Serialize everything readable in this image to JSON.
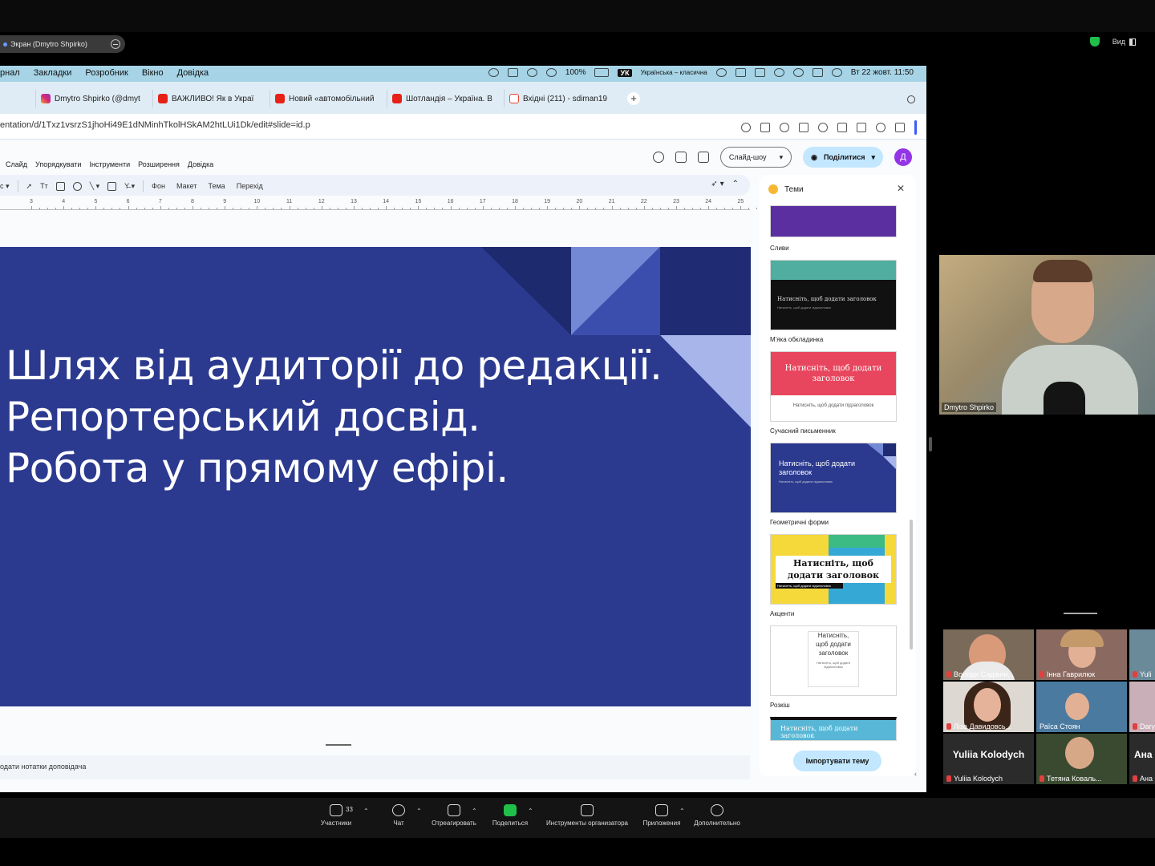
{
  "zoom": {
    "share_label": "Экран (Dmytro Shpirko)",
    "view_label": "Вид",
    "bottom_controls": [
      {
        "label": "Участники",
        "count": "33",
        "icon": "participants-icon"
      },
      {
        "label": "Чат",
        "icon": "chat-icon"
      },
      {
        "label": "Отреагировать",
        "icon": "heart-icon"
      },
      {
        "label": "Поделиться",
        "icon": "share-screen-icon"
      },
      {
        "label": "Инструменты организатора",
        "icon": "shield-icon"
      },
      {
        "label": "Приложения",
        "icon": "apps-icon"
      },
      {
        "label": "Дополнительно",
        "icon": "more-icon"
      }
    ],
    "speaker_name": "Dmytro Shpirko",
    "gallery": [
      {
        "name": "Володя Садівни..."
      },
      {
        "name": "Інна Гаврилюк"
      },
      {
        "name": "Yuli"
      },
      {
        "name": "Ліза Давидовсь..."
      },
      {
        "name": "Раїса Стоян"
      },
      {
        "name": "Dary"
      },
      {
        "name": "Yuliia Kolodych",
        "big": "Yuliia Kolodych"
      },
      {
        "name": "Тетяна Коваль..."
      },
      {
        "name": "Ана",
        "big": "Ана"
      }
    ]
  },
  "mac": {
    "menu": [
      "рнал",
      "Закладки",
      "Розробник",
      "Вікно",
      "Довідка"
    ],
    "battery": "100%",
    "input_source": "УК",
    "layout_name": "Українська – класична",
    "datetime": "Вт 22 жовт.  11:50"
  },
  "browser": {
    "tabs": [
      {
        "title": "Dmytro Shpirko (@dmyt",
        "icon": "instagram-icon"
      },
      {
        "title": "ВАЖЛИВО! Як в Украї",
        "icon": "youtube-icon"
      },
      {
        "title": "Новий «автомобільний",
        "icon": "youtube-icon"
      },
      {
        "title": "Шотландія – Україна. В",
        "icon": "youtube-icon"
      },
      {
        "title": "Вхідні (211) - sdiman19",
        "icon": "gmail-icon"
      }
    ],
    "url": "entation/d/1Txz1vsrzS1jhoHi49E1dNMinhTkolHSkAM2htLUi1Dk/edit#slide=id.p"
  },
  "docs": {
    "menu": [
      "Слайд",
      "Упорядкувати",
      "Інструменти",
      "Розширення",
      "Довідка"
    ],
    "slideshow_label": "Слайд-шоу",
    "share_label": "Поділитися",
    "avatar_letter": "Д",
    "toolbar_items": [
      "Фон",
      "Макет",
      "Тема",
      "Перехід"
    ],
    "ruler": [
      "3",
      "4",
      "5",
      "6",
      "7",
      "8",
      "9",
      "10",
      "11",
      "12",
      "13",
      "14",
      "15",
      "16",
      "17",
      "18",
      "19",
      "20",
      "21",
      "22",
      "23",
      "24",
      "25"
    ],
    "slide_lines": [
      "Шлях від аудиторії до редакції.",
      "Репортерський досвід.",
      "Робота у прямому ефірі."
    ],
    "notes_placeholder": "одати нотатки доповідача",
    "themes_title": "Теми",
    "themes": [
      {
        "name": "Сливи",
        "color": "#5b2fa0"
      },
      {
        "name": "М'яка обкладинка",
        "thumb_title": "Натисніть, щоб додати заголовок",
        "thumb_sub": "Натисніть, щоб додати підзаголовок"
      },
      {
        "name": "Сучасний письменник",
        "thumb_title": "Натисніть, щоб додати заголовок",
        "thumb_sub": "Натисніть, щоб додати підзаголовок"
      },
      {
        "name": "Геометричні форми",
        "thumb_title": "Натисніть, щоб додати заголовок",
        "thumb_sub": "Натисніть, щоб додати підзаголовок"
      },
      {
        "name": "Акценти",
        "thumb_title": "Натисніть, щоб додати заголовок",
        "thumb_sub": "Натисніть, щоб додати підзаголовок"
      },
      {
        "name": "Розкіш",
        "thumb_title": "Натисніть, щоб додати заголовок",
        "thumb_sub": "Натисніть, щоб додати підзаголовок"
      },
      {
        "name": "",
        "thumb_title": "Натисніть, щоб додати заголовок"
      }
    ],
    "import_label": "Імпортувати тему"
  }
}
